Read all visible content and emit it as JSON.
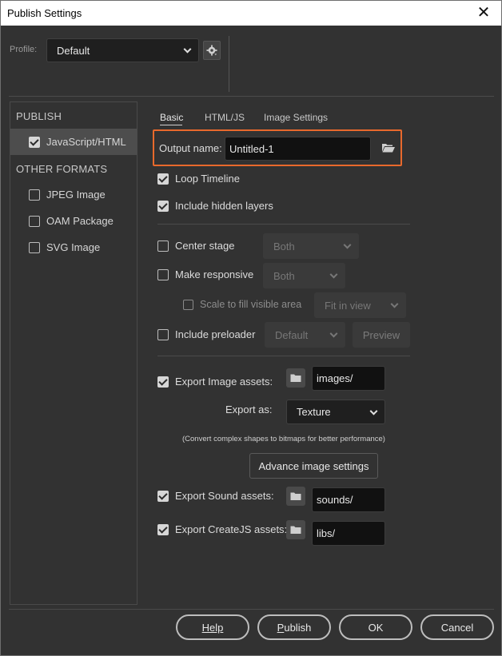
{
  "window": {
    "title": "Publish Settings"
  },
  "profile": {
    "label": "Profile:",
    "value": "Default"
  },
  "left_panel": {
    "publish_heading": "PUBLISH",
    "publish_items": [
      {
        "label": "JavaScript/HTML",
        "checked": true,
        "selected": true
      }
    ],
    "other_heading": "OTHER FORMATS",
    "other_items": [
      {
        "label": "JPEG Image",
        "checked": false
      },
      {
        "label": "OAM Package",
        "checked": false
      },
      {
        "label": "SVG Image",
        "checked": false
      }
    ]
  },
  "tabs": [
    {
      "label": "Basic",
      "active": true
    },
    {
      "label": "HTML/JS",
      "active": false
    },
    {
      "label": "Image Settings",
      "active": false
    }
  ],
  "output": {
    "label": "Output name:",
    "value": "Untitled-1"
  },
  "options": {
    "loop_timeline": {
      "label": "Loop Timeline",
      "checked": true
    },
    "include_hidden": {
      "label": "Include hidden layers",
      "checked": true
    },
    "center_stage": {
      "label": "Center stage",
      "checked": false,
      "dropdown": "Both"
    },
    "make_responsive": {
      "label": "Make responsive",
      "checked": false,
      "dropdown": "Both"
    },
    "scale_fill": {
      "label": "Scale to fill visible area",
      "checked": false,
      "dropdown": "Fit in view"
    },
    "include_preloader": {
      "label": "Include preloader",
      "checked": false,
      "dropdown": "Default",
      "preview_label": "Preview"
    }
  },
  "export_image": {
    "label": "Export Image assets:",
    "checked": true,
    "path": "images/"
  },
  "export_as": {
    "label": "Export as:",
    "value": "Texture"
  },
  "note": "(Convert complex shapes to bitmaps for better performance)",
  "advance_button": "Advance image settings",
  "export_sound": {
    "label": "Export Sound assets:",
    "checked": true,
    "path": "sounds/"
  },
  "export_createjs": {
    "label": "Export CreateJS assets:",
    "checked": true,
    "path": "libs/"
  },
  "footer": {
    "help": "Help",
    "publish": "Publish",
    "ok": "OK",
    "cancel": "Cancel"
  },
  "colors": {
    "background": "#323232",
    "highlight_border": "#e8692c",
    "field_bg": "#111111"
  }
}
